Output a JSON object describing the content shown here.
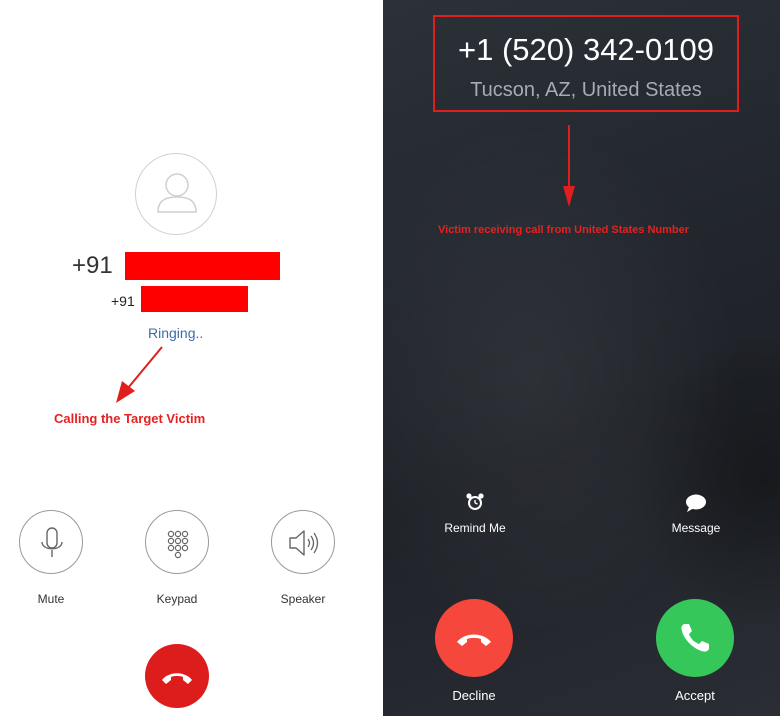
{
  "outgoing": {
    "number_prefix": "+91",
    "secondary_prefix": "+91",
    "status": "Ringing..",
    "annotation": "Calling the Target Victim",
    "controls": {
      "mute": "Mute",
      "keypad": "Keypad",
      "speaker": "Speaker"
    },
    "redaction_color": "#ff0000",
    "end_button_color": "#dd1c1c"
  },
  "incoming": {
    "caller_number": "+1 (520) 342-0109",
    "caller_location": "Tucson, AZ, United States",
    "annotation": "Victim receiving call from United States Number",
    "remind_label": "Remind Me",
    "message_label": "Message",
    "decline_label": "Decline",
    "accept_label": "Accept",
    "decline_color": "#f5473c",
    "accept_color": "#35c759",
    "icons": [
      "alarm-clock-icon",
      "speech-bubble-icon",
      "phone-hangup-icon",
      "phone-icon"
    ]
  },
  "annotation_color": "#e01e1e"
}
